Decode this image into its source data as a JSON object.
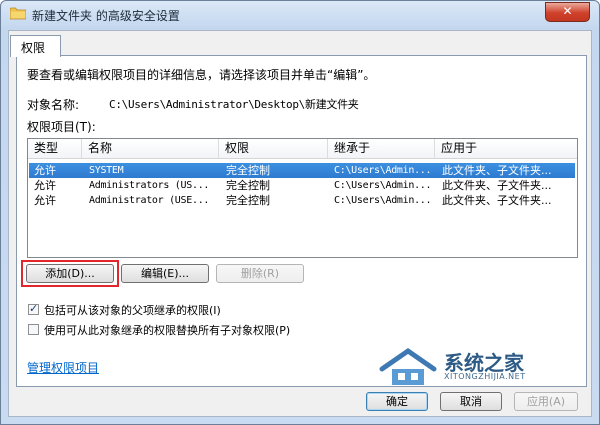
{
  "window": {
    "title": "新建文件夹 的高级安全设置",
    "close_label": "✕"
  },
  "tabs": [
    {
      "label": "权限",
      "active": true
    }
  ],
  "intro_text": "要查看或编辑权限项目的详细信息，请选择该项目并单击“编辑”。",
  "object_name": {
    "label": "对象名称:",
    "value": "C:\\Users\\Administrator\\Desktop\\新建文件夹"
  },
  "entries_label": "权限项目(T):",
  "table": {
    "columns": [
      "类型",
      "名称",
      "权限",
      "继承于",
      "应用于"
    ],
    "rows": [
      {
        "type": "允许",
        "name": "SYSTEM",
        "permission": "完全控制",
        "inherited_from": "C:\\Users\\Admin...",
        "applies_to": "此文件夹、子文件夹...",
        "selected": true
      },
      {
        "type": "允许",
        "name": "Administrators (US...",
        "permission": "完全控制",
        "inherited_from": "C:\\Users\\Admin...",
        "applies_to": "此文件夹、子文件夹..."
      },
      {
        "type": "允许",
        "name": "Administrator (USE...",
        "permission": "完全控制",
        "inherited_from": "C:\\Users\\Admin...",
        "applies_to": "此文件夹、子文件夹..."
      }
    ]
  },
  "buttons": {
    "add": "添加(D)...",
    "edit": "编辑(E)...",
    "remove": "删除(R)"
  },
  "checkboxes": [
    {
      "label": "包括可从该对象的父项继承的权限(I)",
      "checked": true
    },
    {
      "label": "使用可从此对象继承的权限替换所有子对象权限(P)",
      "checked": false
    }
  ],
  "manage_link": "管理权限项目",
  "watermark": {
    "name": "系统之家",
    "url": "XITONGZHIJIA.NET"
  },
  "footer_buttons": {
    "ok": "确定",
    "cancel": "取消",
    "apply": "应用(A)"
  },
  "colors": {
    "selection": "#3388dd",
    "highlight_box": "#e2262c",
    "link": "#0066cc"
  }
}
